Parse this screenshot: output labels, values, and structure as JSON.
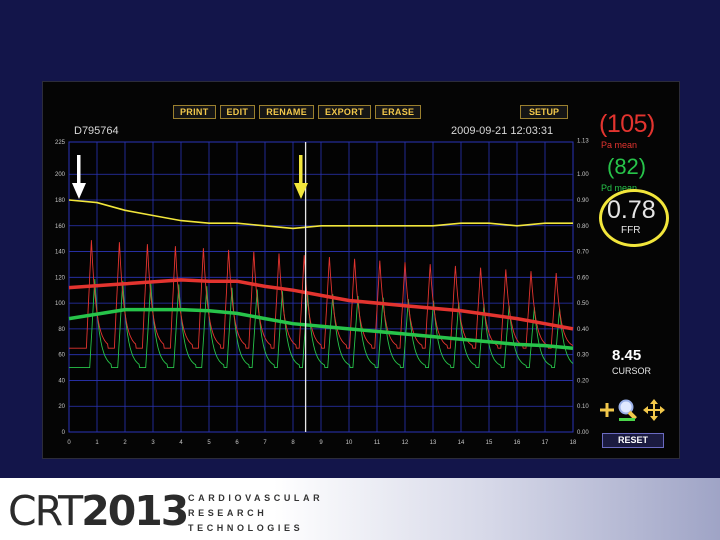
{
  "toolbar": {
    "buttons": [
      "PRINT",
      "EDIT",
      "RENAME",
      "EXPORT",
      "ERASE"
    ],
    "setup_label": "SETUP"
  },
  "record": {
    "id": "D795764",
    "timestamp": "2009-09-21 12:03:31"
  },
  "readouts": {
    "pa_value": "(105)",
    "pa_label": "Pa mean",
    "pd_value": "(82)",
    "pd_label": "Pd mean",
    "ffr_value": "0.78",
    "ffr_label": "FFR",
    "cursor_value": "8.45",
    "cursor_label": "CURSOR",
    "reset_label": "RESET"
  },
  "icons": {
    "zoom_in": "plus-icon",
    "zoom": "magnifier-icon",
    "pan": "move-icon"
  },
  "colors": {
    "pa": "#e3342f",
    "pd": "#27c44a",
    "ffr": "#f2e63b",
    "grid": "#2b34b8",
    "toolbar_text": "#f2c84b"
  },
  "chart_data": {
    "type": "line",
    "x_ticks": [
      "0",
      "1",
      "2",
      "3",
      "4",
      "5",
      "6",
      "7",
      "8",
      "9",
      "10",
      "11",
      "12",
      "13",
      "14",
      "15",
      "16",
      "17",
      "18"
    ],
    "y_left_ticks": [
      "225",
      "200",
      "180",
      "160",
      "140",
      "120",
      "100",
      "80",
      "60",
      "40",
      "20",
      "0"
    ],
    "y_right_ticks": [
      "1.13",
      "1.00",
      "0.90",
      "0.80",
      "0.70",
      "0.60",
      "0.50",
      "0.40",
      "0.30",
      "0.20",
      "0.10",
      "0.00"
    ],
    "xlim": [
      0,
      18
    ],
    "ylim_left": [
      0,
      225
    ],
    "ylim_right": [
      0,
      1.125
    ],
    "cursor_x": 8.45,
    "grid": true,
    "series": [
      {
        "name": "Pa mean",
        "role": "pa_mean",
        "x": [
          0,
          2,
          4,
          5,
          6,
          7,
          8,
          9,
          10,
          12,
          14,
          16,
          17,
          18
        ],
        "y": [
          112,
          115,
          118,
          117,
          117,
          113,
          110,
          106,
          102,
          98,
          94,
          88,
          84,
          80
        ]
      },
      {
        "name": "Pd mean",
        "role": "pd_mean",
        "x": [
          0,
          2,
          4,
          5,
          6,
          7,
          8,
          9,
          10,
          12,
          14,
          16,
          17,
          18
        ],
        "y": [
          88,
          95,
          95,
          94,
          92,
          88,
          84,
          82,
          80,
          76,
          72,
          68,
          67,
          65
        ]
      },
      {
        "name": "FFR",
        "role": "ffr",
        "x": [
          0,
          1,
          2,
          3,
          4,
          5,
          6,
          7,
          8,
          9,
          10,
          11,
          12,
          13,
          14,
          15,
          16,
          17,
          18
        ],
        "y": [
          0.9,
          0.89,
          0.86,
          0.84,
          0.82,
          0.81,
          0.81,
          0.8,
          0.79,
          0.8,
          0.8,
          0.8,
          0.8,
          0.8,
          0.81,
          0.81,
          0.8,
          0.81,
          0.81
        ]
      }
    ],
    "phasic": {
      "pa_peak_times": [
        0.8,
        1.8,
        2.8,
        3.8,
        4.8,
        5.7,
        6.6,
        7.5,
        8.4,
        9.3,
        10.2,
        11.1,
        12.0,
        12.9,
        13.8,
        14.7,
        15.6,
        16.5,
        17.4
      ],
      "pa_max": 150,
      "pa_min": 65,
      "pd_max": 120,
      "pd_min": 50
    }
  }
}
